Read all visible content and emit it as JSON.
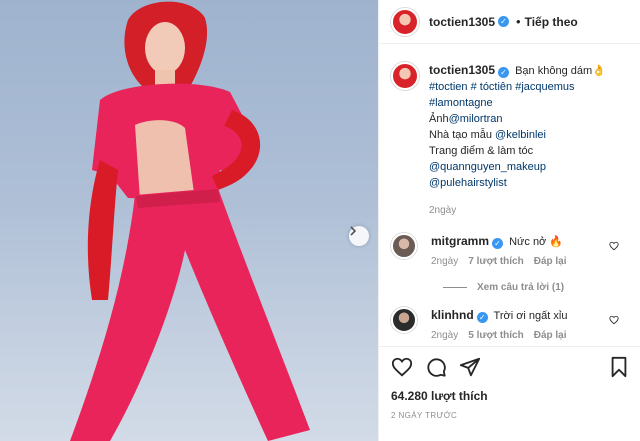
{
  "post": {
    "image_alt": "",
    "next_icon": "chevron-right-icon"
  },
  "header": {
    "username": "toctien1305",
    "separator": "•",
    "follow_label": "Tiếp theo"
  },
  "caption": {
    "username": "toctien1305",
    "text": "Bạn không dám👌",
    "hashtags": "#toctien # tóctiên #jacquemus",
    "hashtag2": "#lamontagne",
    "photo_prefix": "Ảnh",
    "photo_tag": "@milortran",
    "designer_prefix": "Nhà tạo mẫu ",
    "designer_tag": "@kelbinlei",
    "makeup_line": "Trang điểm & làm tóc",
    "makeup_tag": "@quannguyen_makeup",
    "hair_tag": "@pulehairstylist",
    "time": "2ngày"
  },
  "comments": [
    {
      "username": "mitgramm",
      "text": "Nức nở 🔥",
      "time": "2ngày",
      "likes": "7 lượt thích",
      "reply": "Đáp lại"
    },
    {
      "username": "klinhnd",
      "text": "Trời ơi ngất xỉu",
      "time": "2ngày",
      "likes": "5 lượt thích",
      "reply": "Đáp lại"
    }
  ],
  "view_replies": "Xem câu trả lời (1)",
  "footer": {
    "likes": "64.280 lượt thích",
    "date": "2 NGÀY TRƯỚC"
  },
  "colors": {
    "verified": "#3897f0",
    "link": "#00376b",
    "outfit": "#e8245a",
    "hair": "#d9232b"
  }
}
